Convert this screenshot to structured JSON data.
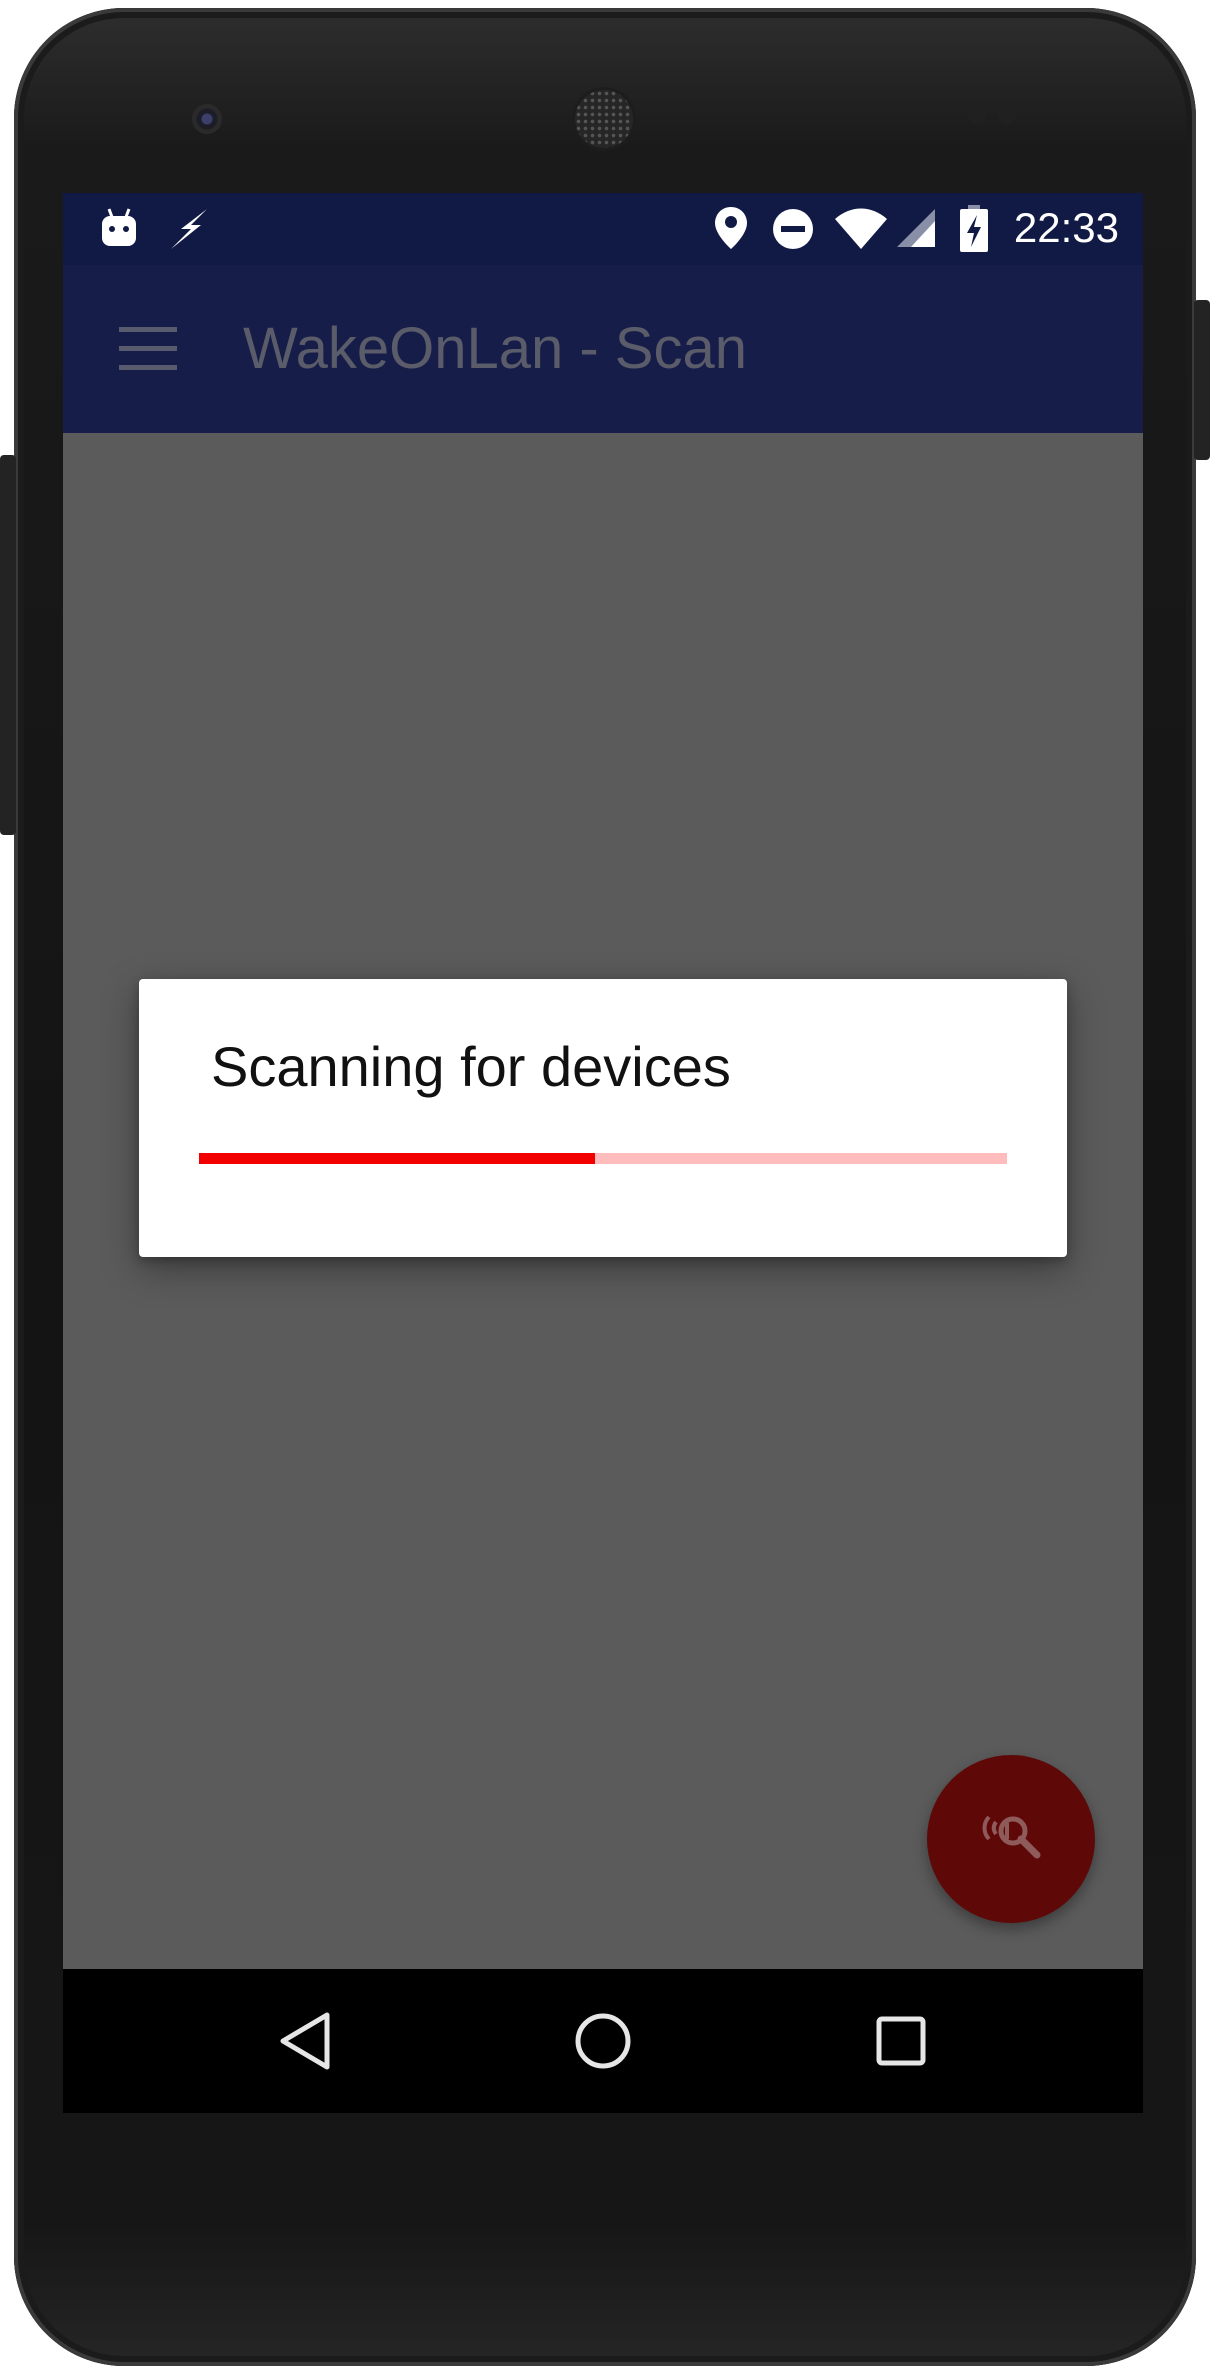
{
  "status_bar": {
    "time": "22:33",
    "icons": [
      "android-notification-icon",
      "flash-icon",
      "location-icon",
      "do-not-disturb-icon",
      "wifi-icon",
      "cell-signal-icon",
      "battery-charging-icon"
    ]
  },
  "app_bar": {
    "title": "WakeOnLan - Scan",
    "menu_icon": "hamburger-menu-icon"
  },
  "dialog": {
    "title": "Scanning for devices",
    "progress": 0.49
  },
  "fab": {
    "icon": "network-scan-icon"
  },
  "nav_bar": {
    "buttons": [
      "back-icon",
      "home-icon",
      "recents-icon"
    ]
  },
  "colors": {
    "status_bar": "#111a45",
    "app_bar": "#171d49",
    "scrim_background": "#5b5b5b",
    "progress_fill": "#f20000",
    "progress_track": "#ffbcbc",
    "fab": "#5e0808"
  }
}
